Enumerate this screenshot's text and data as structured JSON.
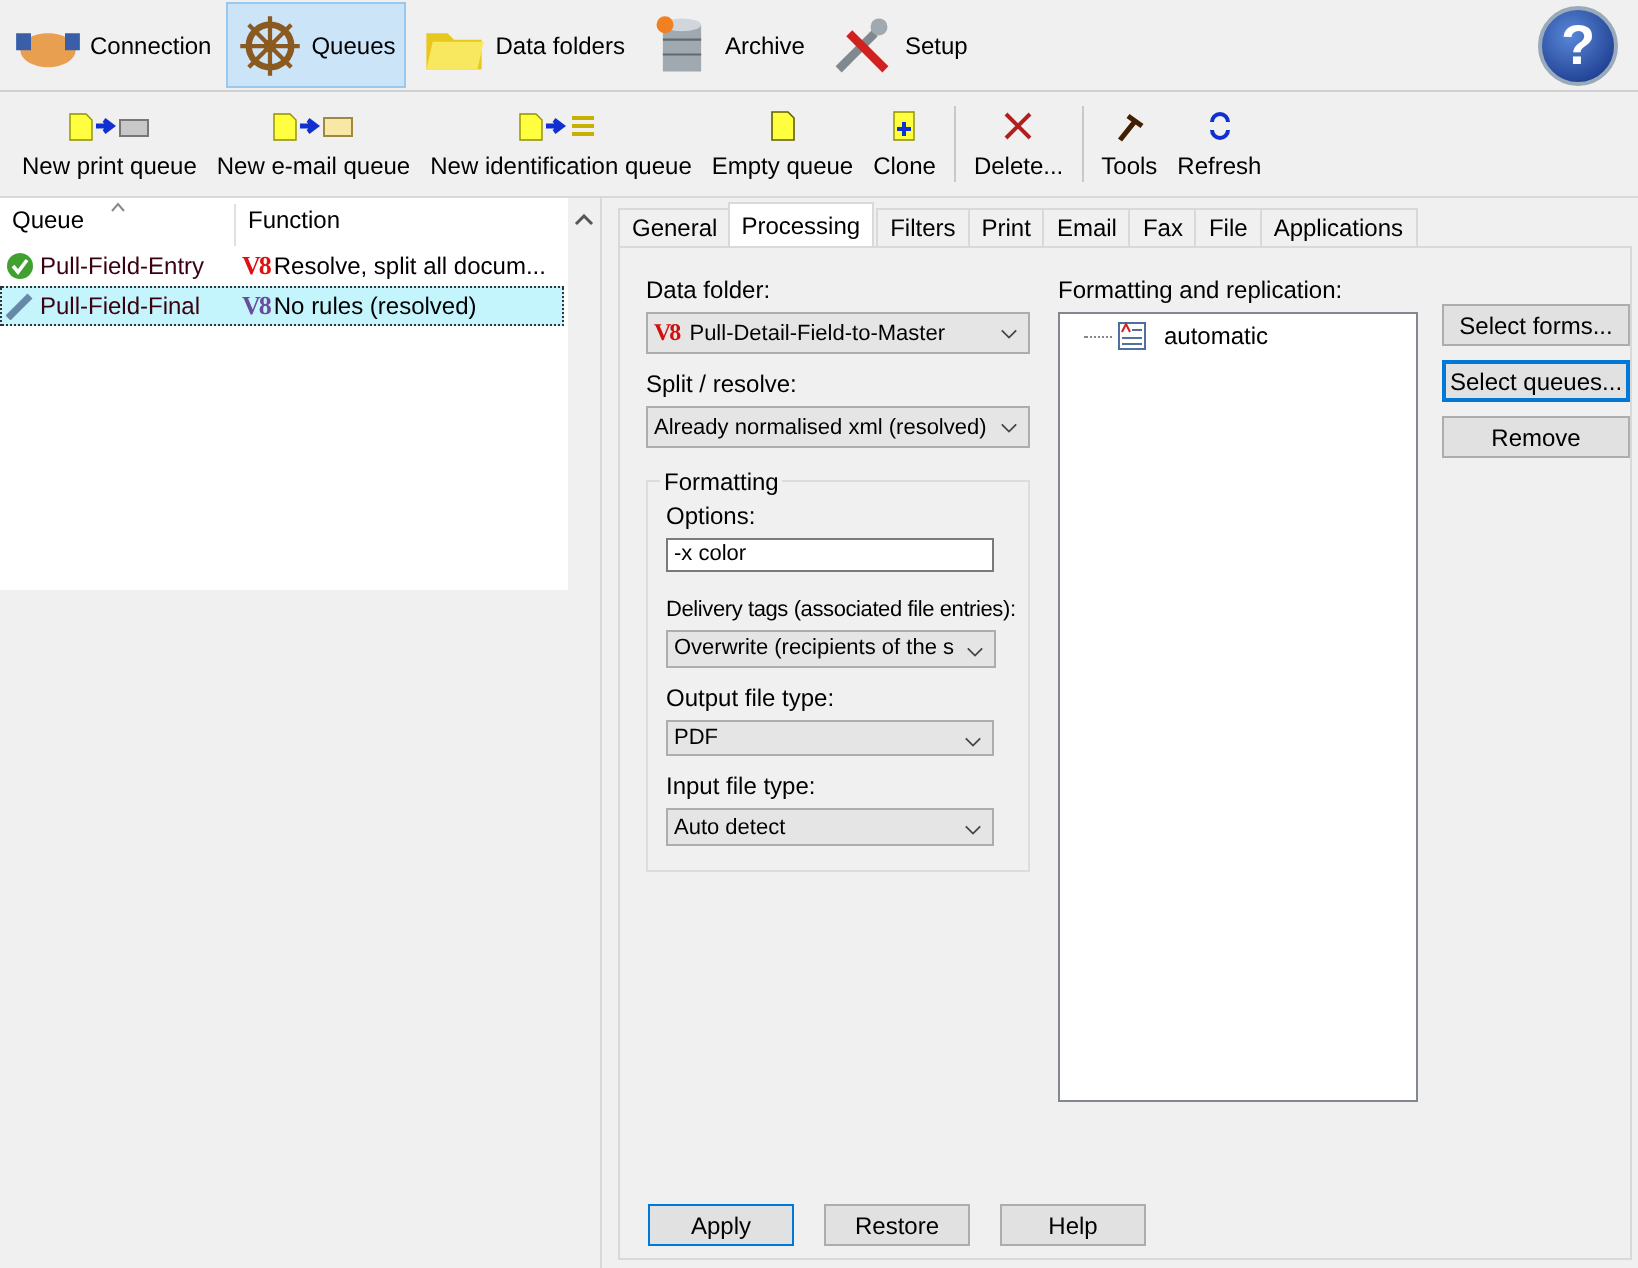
{
  "main_toolbar": [
    {
      "label": "Connection",
      "selected": false
    },
    {
      "label": "Queues",
      "selected": true
    },
    {
      "label": "Data folders",
      "selected": false
    },
    {
      "label": "Archive",
      "selected": false
    },
    {
      "label": "Setup",
      "selected": false
    }
  ],
  "help_button": {
    "glyph": "?"
  },
  "action_toolbar": [
    {
      "label": "New print queue",
      "separator_before": false
    },
    {
      "label": "New e-mail queue",
      "separator_before": false
    },
    {
      "label": "New identification queue",
      "separator_before": false
    },
    {
      "label": "Empty queue",
      "separator_before": false
    },
    {
      "label": "Clone",
      "separator_before": false
    },
    {
      "label": "Delete...",
      "separator_before": true
    },
    {
      "label": "Tools",
      "separator_before": true
    },
    {
      "label": "Refresh",
      "separator_before": false
    }
  ],
  "queue_list": {
    "columns": [
      "Queue",
      "Function"
    ],
    "rows": [
      {
        "kind": "check",
        "name": "Pull-Field-Entry",
        "badge": "V8",
        "color": "#e01010",
        "function": "Resolve, split all docum...",
        "selected": false
      },
      {
        "kind": "pencil",
        "name": "Pull-Field-Final",
        "badge": "V8",
        "color": "#6a4c9c",
        "function": "No rules (resolved)",
        "selected": true
      }
    ]
  },
  "tabs": [
    {
      "label": "General",
      "selected": false
    },
    {
      "label": "Processing",
      "selected": true
    },
    {
      "label": "Filters",
      "selected": false
    },
    {
      "label": "Print",
      "selected": false
    },
    {
      "label": "Email",
      "selected": false
    },
    {
      "label": "Fax",
      "selected": false
    },
    {
      "label": "File",
      "selected": false
    },
    {
      "label": "Applications",
      "selected": false
    }
  ],
  "processing": {
    "data_folder": {
      "label": "Data folder:",
      "badge": "V8",
      "value": "Pull-Detail-Field-to-Master"
    },
    "split_resolve": {
      "label": "Split / resolve:",
      "value": "Already normalised xml (resolved)"
    },
    "formatting": {
      "title": "Formatting",
      "options": {
        "label": "Options:",
        "value": "-x color"
      },
      "delivery_tags": {
        "label": "Delivery tags (associated file entries):",
        "value": "Overwrite (recipients of the s"
      },
      "output_file_type": {
        "label": "Output file type:",
        "value": "PDF"
      },
      "input_file_type": {
        "label": "Input file type:",
        "value": "Auto detect"
      }
    },
    "replication": {
      "label": "Formatting and replication:",
      "items": [
        "automatic"
      ]
    },
    "side_buttons": [
      {
        "label": "Select forms...",
        "focused": false
      },
      {
        "label": "Select queues...",
        "focused": true
      },
      {
        "label": "Remove",
        "focused": false
      }
    ]
  },
  "footer_buttons": [
    "Apply",
    "Restore",
    "Help"
  ]
}
